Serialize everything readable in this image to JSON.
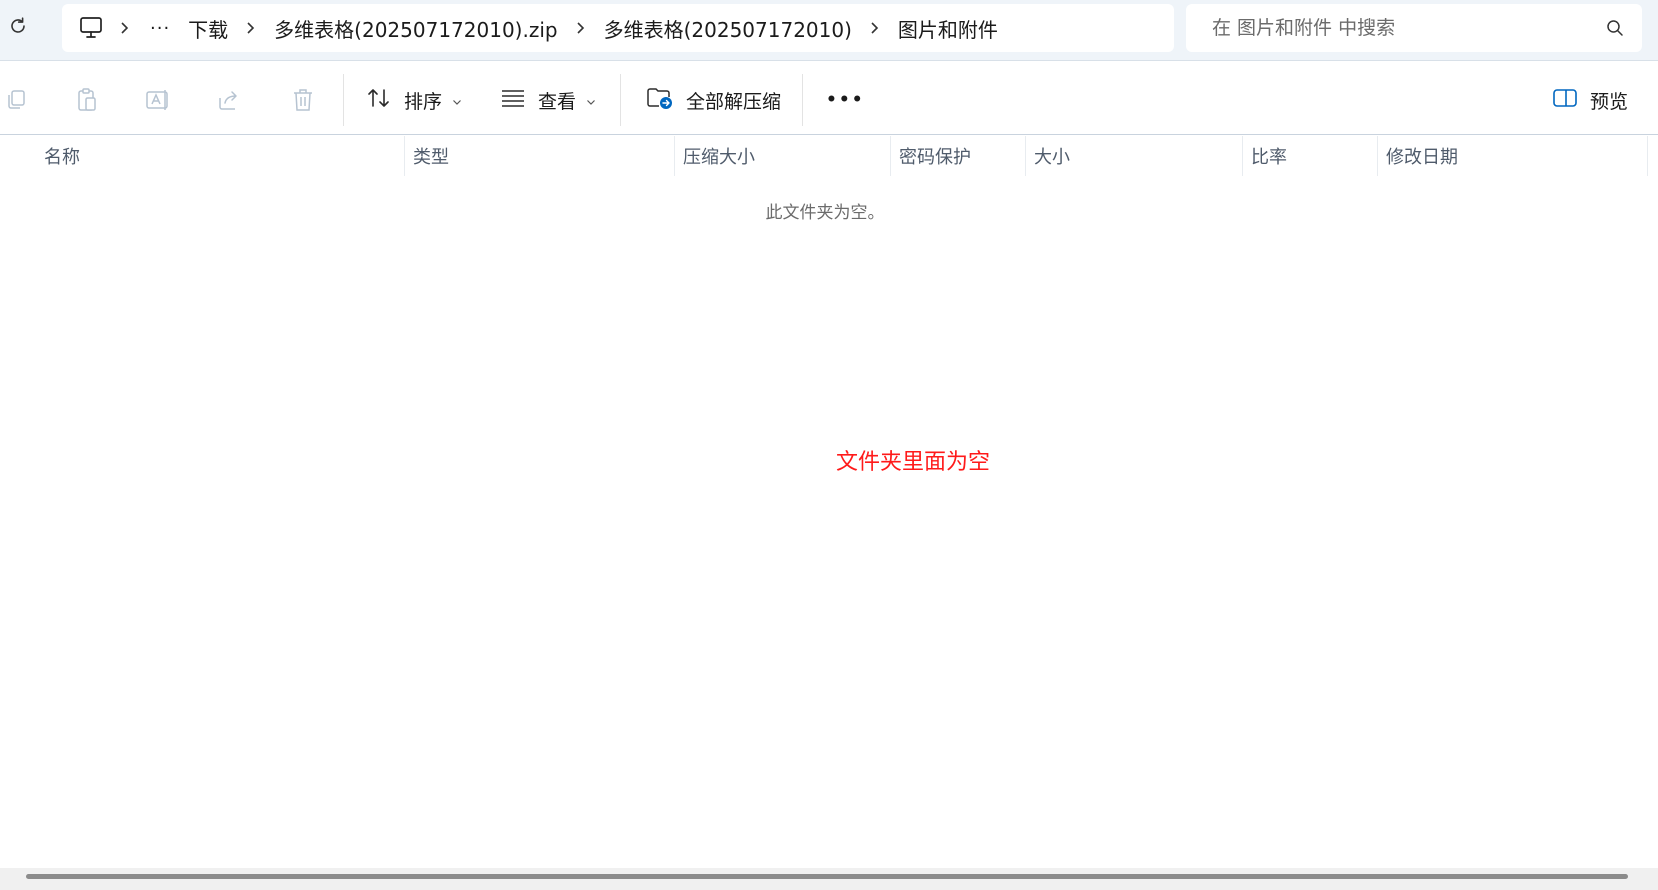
{
  "address_bar": {
    "breadcrumb": {
      "more": "···",
      "items": [
        "下载",
        "多维表格(202507172010).zip",
        "多维表格(202507172010)",
        "图片和附件"
      ]
    },
    "search": {
      "placeholder": "在 图片和附件 中搜索",
      "value": ""
    }
  },
  "command_bar": {
    "sort_label": "排序",
    "view_label": "查看",
    "extract_all_label": "全部解压缩",
    "more": "•••",
    "preview_label": "预览"
  },
  "columns": [
    "名称",
    "类型",
    "压缩大小",
    "密码保护",
    "大小",
    "比率",
    "修改日期"
  ],
  "content": {
    "empty_text": "此文件夹为空。",
    "annotation": "文件夹里面为空"
  },
  "colors": {
    "annotation": "#ff1a1a",
    "addr_bg": "#eff4f9",
    "accent": "#0067c0"
  },
  "icons": [
    "refresh-icon",
    "this-pc-icon",
    "chevron-right-icon",
    "search-icon",
    "copy-icon",
    "paste-icon",
    "rename-icon",
    "share-icon",
    "delete-icon",
    "sort-icon",
    "view-icon",
    "extract-all-icon",
    "preview-pane-icon",
    "sort-ascending-icon"
  ]
}
